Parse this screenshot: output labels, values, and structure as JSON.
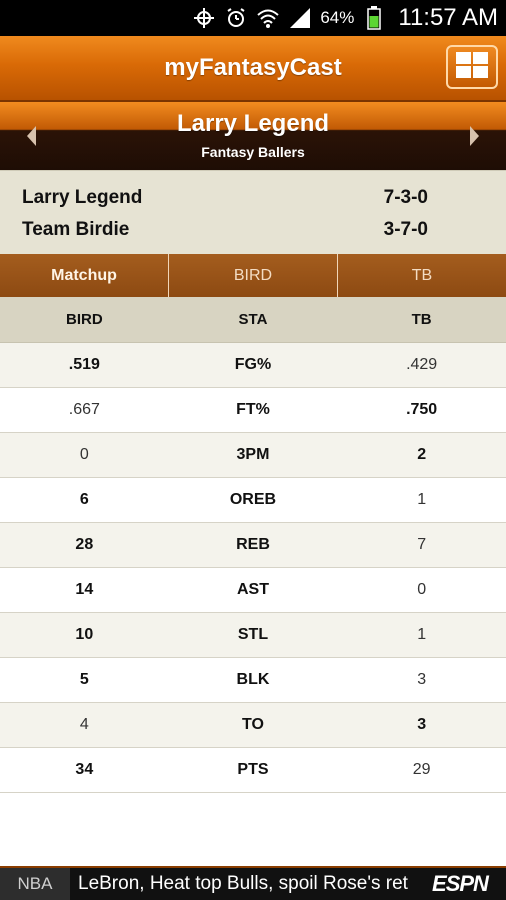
{
  "status_bar": {
    "battery_percent": "64%",
    "time": "11:57 AM",
    "icons": [
      "gps-icon",
      "alarm-icon",
      "wifi-icon",
      "signal-icon",
      "battery-icon"
    ]
  },
  "header": {
    "title": "myFantasyCast",
    "menu_icon": "grid-icon"
  },
  "team_nav": {
    "team_name": "Larry Legend",
    "league_name": "Fantasy Ballers",
    "prev_icon": "chevron-left-icon",
    "next_icon": "chevron-right-icon"
  },
  "records": [
    {
      "team": "Larry Legend",
      "record": "7-3-0"
    },
    {
      "team": "Team Birdie",
      "record": "3-7-0"
    }
  ],
  "tabs": [
    {
      "label": "Matchup",
      "active": true
    },
    {
      "label": "BIRD",
      "active": false
    },
    {
      "label": "TB",
      "active": false
    }
  ],
  "stats": {
    "columns": [
      "BIRD",
      "STA",
      "TB"
    ],
    "rows": [
      {
        "left": ".519",
        "cat": "FG%",
        "right": ".429",
        "winner": "left"
      },
      {
        "left": ".667",
        "cat": "FT%",
        "right": ".750",
        "winner": "right"
      },
      {
        "left": "0",
        "cat": "3PM",
        "right": "2",
        "winner": "right"
      },
      {
        "left": "6",
        "cat": "OREB",
        "right": "1",
        "winner": "left"
      },
      {
        "left": "28",
        "cat": "REB",
        "right": "7",
        "winner": "left"
      },
      {
        "left": "14",
        "cat": "AST",
        "right": "0",
        "winner": "left"
      },
      {
        "left": "10",
        "cat": "STL",
        "right": "1",
        "winner": "left"
      },
      {
        "left": "5",
        "cat": "BLK",
        "right": "3",
        "winner": "left"
      },
      {
        "left": "4",
        "cat": "TO",
        "right": "3",
        "winner": "right"
      },
      {
        "left": "34",
        "cat": "PTS",
        "right": "29",
        "winner": "left"
      }
    ]
  },
  "ticker": {
    "sport": "NBA",
    "headline": "LeBron, Heat top Bulls, spoil Rose's ret",
    "brand": "ESPN"
  },
  "colors": {
    "accent": "#d96a06",
    "tab_bg": "#9a5418",
    "records_bg": "#e6e3d3"
  }
}
